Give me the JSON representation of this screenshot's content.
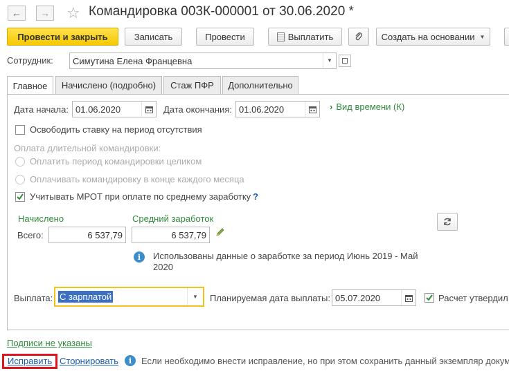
{
  "window": {
    "title": "Командировка 003К-000001 от 30.06.2020 *"
  },
  "toolbar": {
    "post_close": "Провести и закрыть",
    "save": "Записать",
    "post": "Провести",
    "pay": "Выплатить",
    "create_based": "Создать на основании"
  },
  "employee": {
    "label": "Сотрудник:",
    "value": "Симутина Елена Францевна"
  },
  "tabs": [
    {
      "label": "Главное",
      "active": true
    },
    {
      "label": "Начислено (подробно)",
      "active": false
    },
    {
      "label": "Стаж ПФР",
      "active": false
    },
    {
      "label": "Дополнительно",
      "active": false
    }
  ],
  "dates": {
    "start_label": "Дата начала:",
    "start_value": "01.06.2020",
    "end_label": "Дата окончания:",
    "end_value": "01.06.2020",
    "time_kind_link": "Вид времени (К)"
  },
  "release_rate": {
    "label": "Освободить ставку на период отсутствия",
    "checked": false
  },
  "long_trip": {
    "label": "Оплата длительной командировки:",
    "options": [
      "Оплатить период командировки целиком",
      "Оплачивать командировку в конце каждого месяца"
    ]
  },
  "mrot": {
    "label": "Учитывать МРОТ при оплате по среднему заработку",
    "checked": true,
    "help": "?"
  },
  "amounts": {
    "accrued_header": "Начислено",
    "avg_header": "Средний заработок",
    "total_label": "Всего:",
    "accrued_value": "6 537,79",
    "avg_value": "6 537,79",
    "info_text_line1": "Использованы данные о заработке за период Июнь 2019 - Май",
    "info_text_line2": "2020"
  },
  "payment": {
    "label": "Выплата:",
    "value": "С зарплатой",
    "planned_label": "Планируемая дата выплаты:",
    "planned_value": "05.07.2020",
    "approved_label": "Расчет утвердил",
    "approved_checked": true
  },
  "footer": {
    "signatures_link": "Подписи не указаны",
    "fix_link": "Исправить",
    "reverse_link": "Сторнировать",
    "info_text": "Если необходимо внести исправление, но при этом сохранить данный экземпляр докум"
  },
  "colors": {
    "accent_yellow": "#f5c900",
    "green": "#2e8b3a",
    "link_blue": "#1a5cac",
    "highlight_red": "#e0141e",
    "selection_blue": "#3d6fc1"
  }
}
